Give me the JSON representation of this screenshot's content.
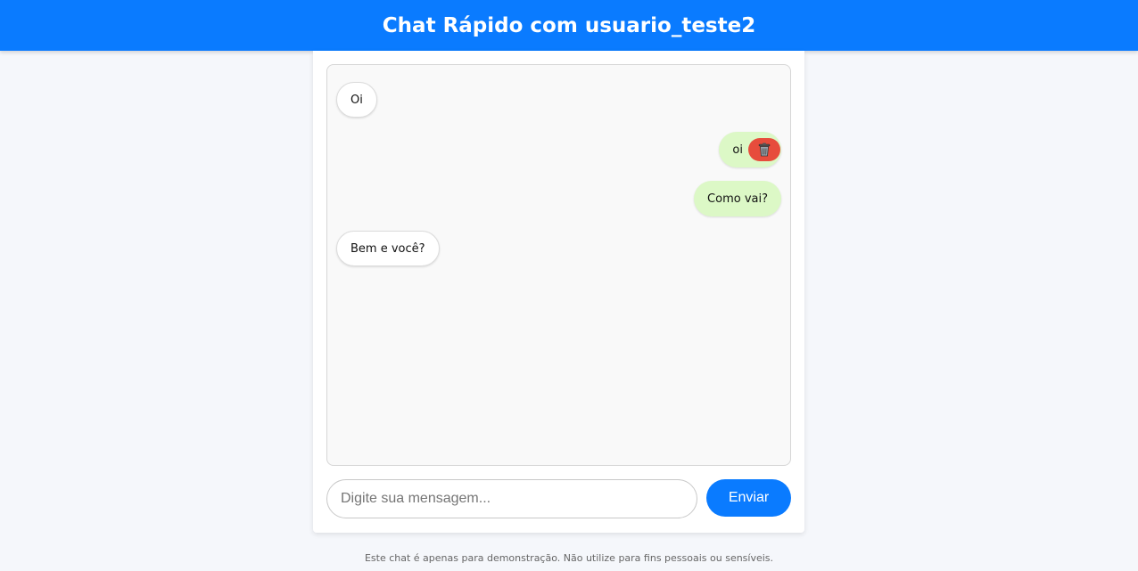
{
  "header": {
    "title": "Chat Rápido com usuario_teste2"
  },
  "colors": {
    "accent": "#0a7bff",
    "sent_bubble": "#dcf8c6",
    "received_bubble": "#ffffff",
    "delete": "#e74c3c"
  },
  "messages": [
    {
      "text": "Oi",
      "direction": "received"
    },
    {
      "text": "oi",
      "direction": "sent",
      "delete_icon": "trash-icon"
    },
    {
      "text": "Como vai?",
      "direction": "sent"
    },
    {
      "text": "Bem e você?",
      "direction": "received"
    }
  ],
  "composer": {
    "placeholder": "Digite sua mensagem...",
    "value": "",
    "send_label": "Enviar"
  },
  "footer": {
    "disclaimer": "Este chat é apenas para demonstração. Não utilize para fins pessoais ou sensíveis."
  }
}
